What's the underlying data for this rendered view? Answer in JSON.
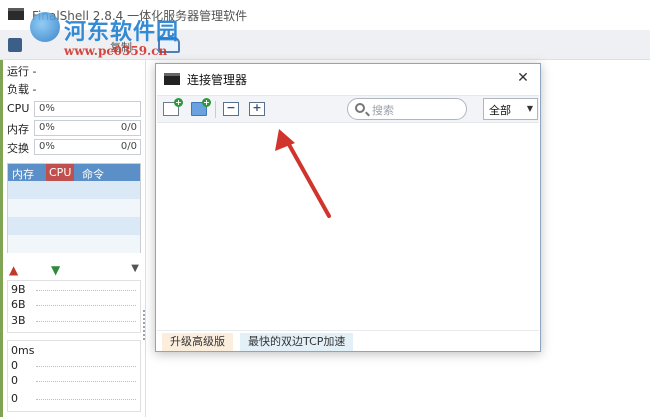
{
  "window": {
    "title": "FinalShell 2.8.4 一体化服务器管理软件"
  },
  "toolbar": {
    "copy_label": "复制"
  },
  "watermark": {
    "brand": "河东软件园",
    "url": "www.pc0359.cn"
  },
  "sidebar": {
    "run_label": "运行 -",
    "load_label": "负载 -",
    "stats": [
      {
        "label": "CPU",
        "value": "0%",
        "extra": ""
      },
      {
        "label": "内存",
        "value": "0%",
        "extra": "0/0"
      },
      {
        "label": "交换",
        "value": "0%",
        "extra": "0/0"
      }
    ],
    "process_table": {
      "columns": [
        "内存",
        "CPU",
        "命令"
      ],
      "active_column": "CPU"
    },
    "network": {
      "labels": [
        "9B",
        "6B",
        "3B"
      ]
    },
    "ping": {
      "labels": [
        "0ms",
        "0",
        "0",
        "0"
      ]
    }
  },
  "dialog": {
    "title": "连接管理器",
    "search_placeholder": "搜索",
    "filter_selected": "全部",
    "footer_tabs": [
      "升级高级版",
      "最快的双边TCP加速"
    ]
  },
  "colors": {
    "accent_blue": "#5a8fc7",
    "active_red": "#c0504d",
    "annotation_arrow": "#d0342c"
  }
}
